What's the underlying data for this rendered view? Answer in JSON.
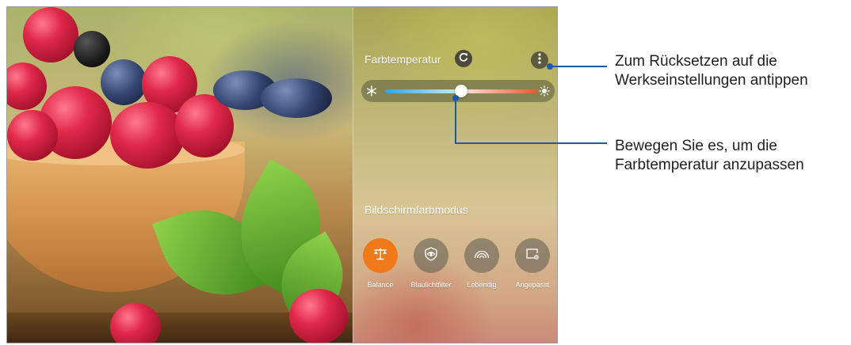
{
  "color_temperature": {
    "title": "Farbtemperatur",
    "icons": {
      "reset": "refresh-icon",
      "menu": "more-vertical-icon",
      "cold": "snowflake-icon",
      "warm": "sun-icon"
    },
    "slider_value": 0.5
  },
  "screen_color_mode": {
    "title": "Bildschirmfarbmodus",
    "modes": [
      {
        "label": "Balance",
        "icon": "balance-scale-icon",
        "active": true
      },
      {
        "label": "Blaulichtfilter",
        "icon": "eye-shield-icon",
        "active": false
      },
      {
        "label": "Lebendig",
        "icon": "rainbow-icon",
        "active": false
      },
      {
        "label": "Angepasst",
        "icon": "custom-screen-icon",
        "active": false
      }
    ]
  },
  "callouts": {
    "reset": {
      "line1": "Zum Rücksetzen auf die",
      "line2": "Werkseinstellungen antippen"
    },
    "slider": {
      "line1": "Bewegen Sie es, um die",
      "line2": "Farbtemperatur anzupassen"
    }
  },
  "colors": {
    "accent": "#f07a1a",
    "callout_line": "#1a5aa8"
  }
}
